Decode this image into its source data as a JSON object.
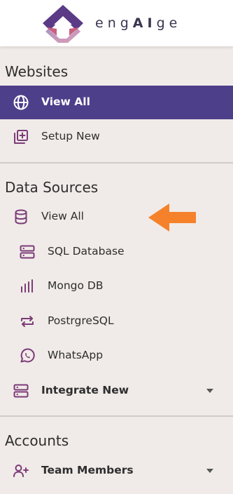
{
  "header": {
    "brand_prefix": "eng",
    "brand_ai": "AI",
    "brand_suffix": "ge"
  },
  "websites": {
    "title": "Websites",
    "view_all": "View All",
    "setup_new": "Setup New"
  },
  "data_sources": {
    "title": "Data Sources",
    "view_all": "View All",
    "sql": "SQL Database",
    "mongo": "Mongo DB",
    "postgres": "PostrgreSQL",
    "whatsapp": "WhatsApp",
    "integrate_new": "Integrate New"
  },
  "accounts": {
    "title": "Accounts",
    "team_members": "Team Members"
  },
  "colors": {
    "active_bg": "#4e3f8a",
    "icon": "#7c3b78",
    "arrow": "#f5822a"
  }
}
